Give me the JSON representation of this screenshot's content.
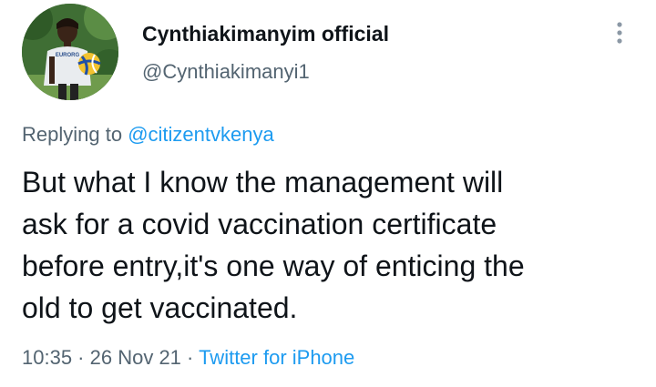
{
  "author": {
    "display_name": "Cynthiakimanyim official",
    "handle": "@Cynthiakimanyi1",
    "avatar_shirt_text": "EURORG"
  },
  "reply": {
    "prefix": "Replying to ",
    "mention": "@citizentvkenya"
  },
  "tweet": {
    "text": "But what I know the management will\nask for a covid vaccination certificate\nbefore entry,it's one way of enticing the\nold to get vaccinated."
  },
  "meta": {
    "time": "10:35",
    "separator_1": " · ",
    "date": "26 Nov 21",
    "separator_2": " · ",
    "source": "Twitter for iPhone"
  },
  "icons": {
    "more": "more-vertical-icon"
  },
  "colors": {
    "text": "#0f1419",
    "secondary": "#536471",
    "link": "#1d9bf0"
  }
}
